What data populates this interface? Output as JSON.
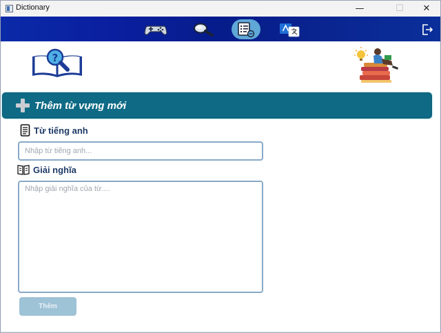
{
  "window": {
    "title": "Dictionary",
    "controls": {
      "minimize": "—",
      "maximize": "☐",
      "close": "✕"
    }
  },
  "navbar": {
    "items": [
      {
        "name": "game",
        "icon": "gamepad-icon",
        "active": false
      },
      {
        "name": "search",
        "icon": "magnifier-icon",
        "active": false
      },
      {
        "name": "word-list",
        "icon": "list-icon",
        "active": true
      },
      {
        "name": "translate",
        "icon": "translate-icon",
        "active": false
      }
    ],
    "logout_icon": "logout-icon",
    "colors": {
      "bar_start": "#0a2aa8",
      "bar_end": "#0a2f9a",
      "active_pill": "#5fa7d6"
    }
  },
  "section": {
    "icon": "plus-icon",
    "title": "Thêm từ vựng mới",
    "color": "#0e6a85"
  },
  "form": {
    "word_label": "Từ tiếng anh",
    "word_placeholder": "Nhập từ tiếng anh...",
    "word_value": "",
    "meaning_label": "Giải nghĩa",
    "meaning_placeholder": "Nhập giải nghĩa của từ....",
    "meaning_value": "",
    "submit_label": "Thêm"
  }
}
